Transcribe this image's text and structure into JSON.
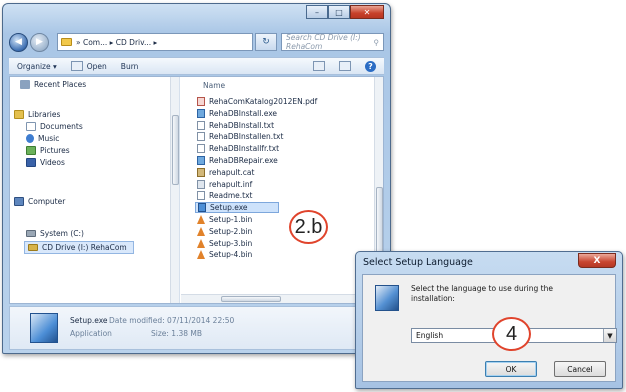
{
  "explorer": {
    "breadcrumb": "» Com... ▸ CD Driv... ▸",
    "search_placeholder": "Search CD Drive (I:) RehaCom",
    "toolbar": {
      "organize": "Organize ▾",
      "open": "Open",
      "burn": "Burn"
    },
    "nav": {
      "recent_places": "Recent Places",
      "libraries": "Libraries",
      "documents": "Documents",
      "music": "Music",
      "pictures": "Pictures",
      "videos": "Videos",
      "computer": "Computer",
      "system": "System (C:)",
      "cd_drive": "CD Drive (I:) RehaCom"
    },
    "column_name": "Name",
    "files": [
      {
        "name": "RehaComKatalog2012EN.pdf",
        "type": "pdf"
      },
      {
        "name": "RehaDBInstall.exe",
        "type": "exe"
      },
      {
        "name": "RehaDBInstall.txt",
        "type": "txt"
      },
      {
        "name": "RehaDBInstallen.txt",
        "type": "txt"
      },
      {
        "name": "RehaDBInstallfr.txt",
        "type": "txt"
      },
      {
        "name": "RehaDBRepair.exe",
        "type": "exe"
      },
      {
        "name": "rehapult.cat",
        "type": "cat"
      },
      {
        "name": "rehapult.inf",
        "type": "inf"
      },
      {
        "name": "Readme.txt",
        "type": "txt"
      },
      {
        "name": "Setup.exe",
        "type": "setup",
        "selected": true
      },
      {
        "name": "Setup-1.bin",
        "type": "bin"
      },
      {
        "name": "Setup-2.bin",
        "type": "bin"
      },
      {
        "name": "Setup-3.bin",
        "type": "bin"
      },
      {
        "name": "Setup-4.bin",
        "type": "bin"
      }
    ],
    "details": {
      "filename": "Setup.exe",
      "date_label": "Date modified: 07/11/2014 22:50",
      "type": "Application",
      "size_label": "Size: 1.38 MB"
    }
  },
  "annotations": {
    "step_explorer": "2.b",
    "step_dialog": "4"
  },
  "dialog": {
    "title": "Select Setup Language",
    "close": "X",
    "message": "Select the language to use during the installation:",
    "selected_language": "English",
    "ok": "OK",
    "cancel": "Cancel"
  }
}
